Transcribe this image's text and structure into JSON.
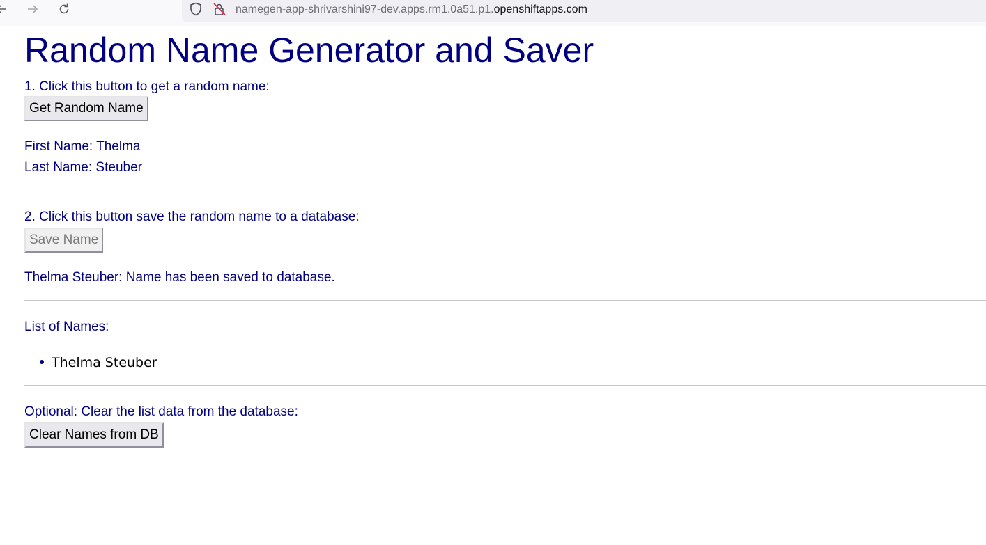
{
  "browser": {
    "url_prefix": "namegen-app-shrivarshini97-dev.apps.rm1.0a51.p1.",
    "url_domain": "openshiftapps.com"
  },
  "page": {
    "title": "Random Name Generator and Saver",
    "step1_label": "1. Click this button to get a random name:",
    "get_button": "Get Random Name",
    "first_name_line": "First Name: Thelma",
    "last_name_line": "Last Name: Steuber",
    "step2_label": "2. Click this button save the random name to a database:",
    "save_button": "Save Name",
    "save_status": "Thelma Steuber: Name has been saved to database.",
    "list_label": "List of Names:",
    "names": [
      "Thelma Steuber"
    ],
    "optional_label": "Optional: Clear the list data from the database:",
    "clear_button": "Clear Names from DB"
  },
  "colors": {
    "text": "#000080",
    "button_bg": "#e9e9ed"
  }
}
